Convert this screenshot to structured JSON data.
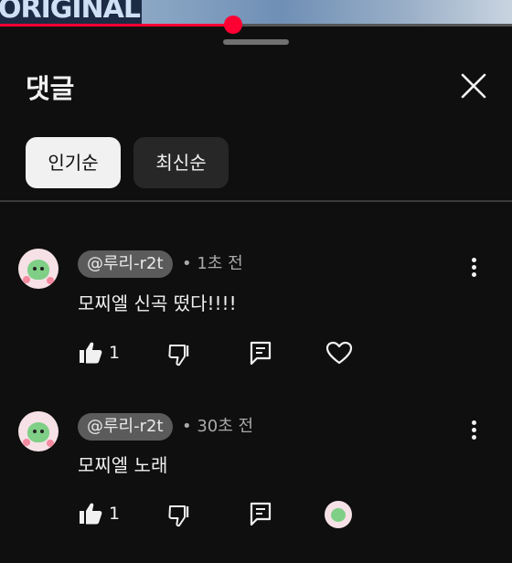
{
  "video": {
    "overlay_text": "ORIGINAL",
    "progress_fraction": 0.455
  },
  "panel": {
    "title": "댓글",
    "close_icon": "close-icon"
  },
  "sort": {
    "options": [
      {
        "label": "인기순",
        "selected": true
      },
      {
        "label": "최신순",
        "selected": false
      }
    ]
  },
  "comments": [
    {
      "handle": "@루리-r2t",
      "time": "• 1초 전",
      "text": "모찌엘 신곡 떴다!!!!",
      "likes": "1"
    },
    {
      "handle": "@루리-r2t",
      "time": "• 30초 전",
      "text": "모찌엘 노래",
      "likes": "1"
    }
  ],
  "colors": {
    "background": "#0f0f0f",
    "accent": "#ff0033",
    "chip_active_bg": "#f1f1f1",
    "chip_inactive_bg": "#272727",
    "handle_pill_bg": "#5b5b5b",
    "secondary_text": "#aaaaaa"
  },
  "icons": [
    "close-icon",
    "like-icon",
    "dislike-icon",
    "reply-icon",
    "heart-icon",
    "more-vert-icon"
  ]
}
